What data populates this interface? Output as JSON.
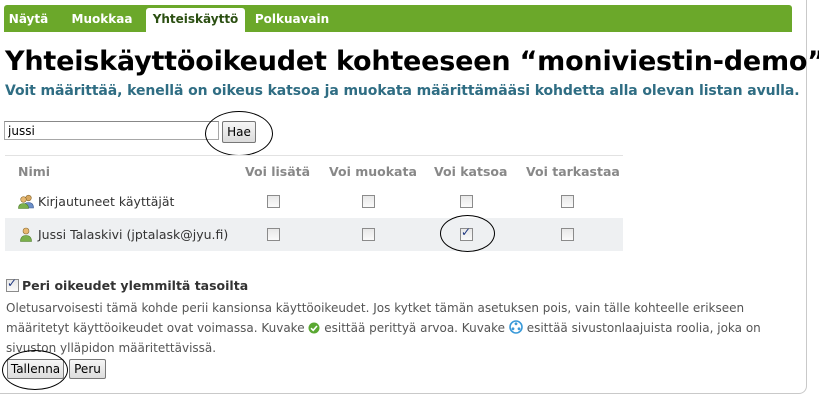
{
  "tabs": [
    {
      "label": "Näytä",
      "active": false
    },
    {
      "label": "Muokkaa",
      "active": false
    },
    {
      "label": "Yhteiskäyttö",
      "active": true
    },
    {
      "label": "Polkuavain",
      "active": false
    }
  ],
  "page": {
    "title": "Yhteiskäyttöoikeudet kohteeseen “moniviestin-demo”",
    "subtitle": "Voit määrittää, kenellä on oikeus katsoa ja muokata määrittämääsi kohdetta alla olevan listan avulla."
  },
  "search": {
    "value": "jussi",
    "button_label": "Hae"
  },
  "table": {
    "headers": [
      "Nimi",
      "Voi lisätä",
      "Voi muokata",
      "Voi katsoa",
      "Voi tarkastaa"
    ],
    "rows": [
      {
        "name": "Kirjautuneet käyttäjät",
        "icon": "users-group-icon",
        "permissions": [
          false,
          false,
          false,
          false
        ]
      },
      {
        "name": "Jussi Talaskivi (jptalask@jyu.fi)",
        "icon": "user-icon",
        "permissions": [
          false,
          false,
          true,
          false
        ]
      }
    ]
  },
  "inherit": {
    "checked": true,
    "label": "Peri oikeudet ylemmiltä tasoilta",
    "desc_part1": "Oletusarvoisesti tämä kohde perii kansionsa käyttöoikeudet. Jos kytket tämän asetuksen pois, vain tälle kohteelle erikseen määritetyt käyttöoikeudet ovat voimassa. Kuvake",
    "desc_part2": "esittää perittyä arvoa. Kuvake",
    "desc_part3": "esittää sivustonlaajuista roolia, joka on sivuston ylläpidon määritettävissä.",
    "inherited_icon": "green-check-icon",
    "sitewide_icon": "site-role-icon"
  },
  "actions": {
    "save_label": "Tallenna",
    "cancel_label": "Peru"
  },
  "colors": {
    "tab_green": "#6ba82a",
    "subtitle_blue": "#2f6d83"
  }
}
